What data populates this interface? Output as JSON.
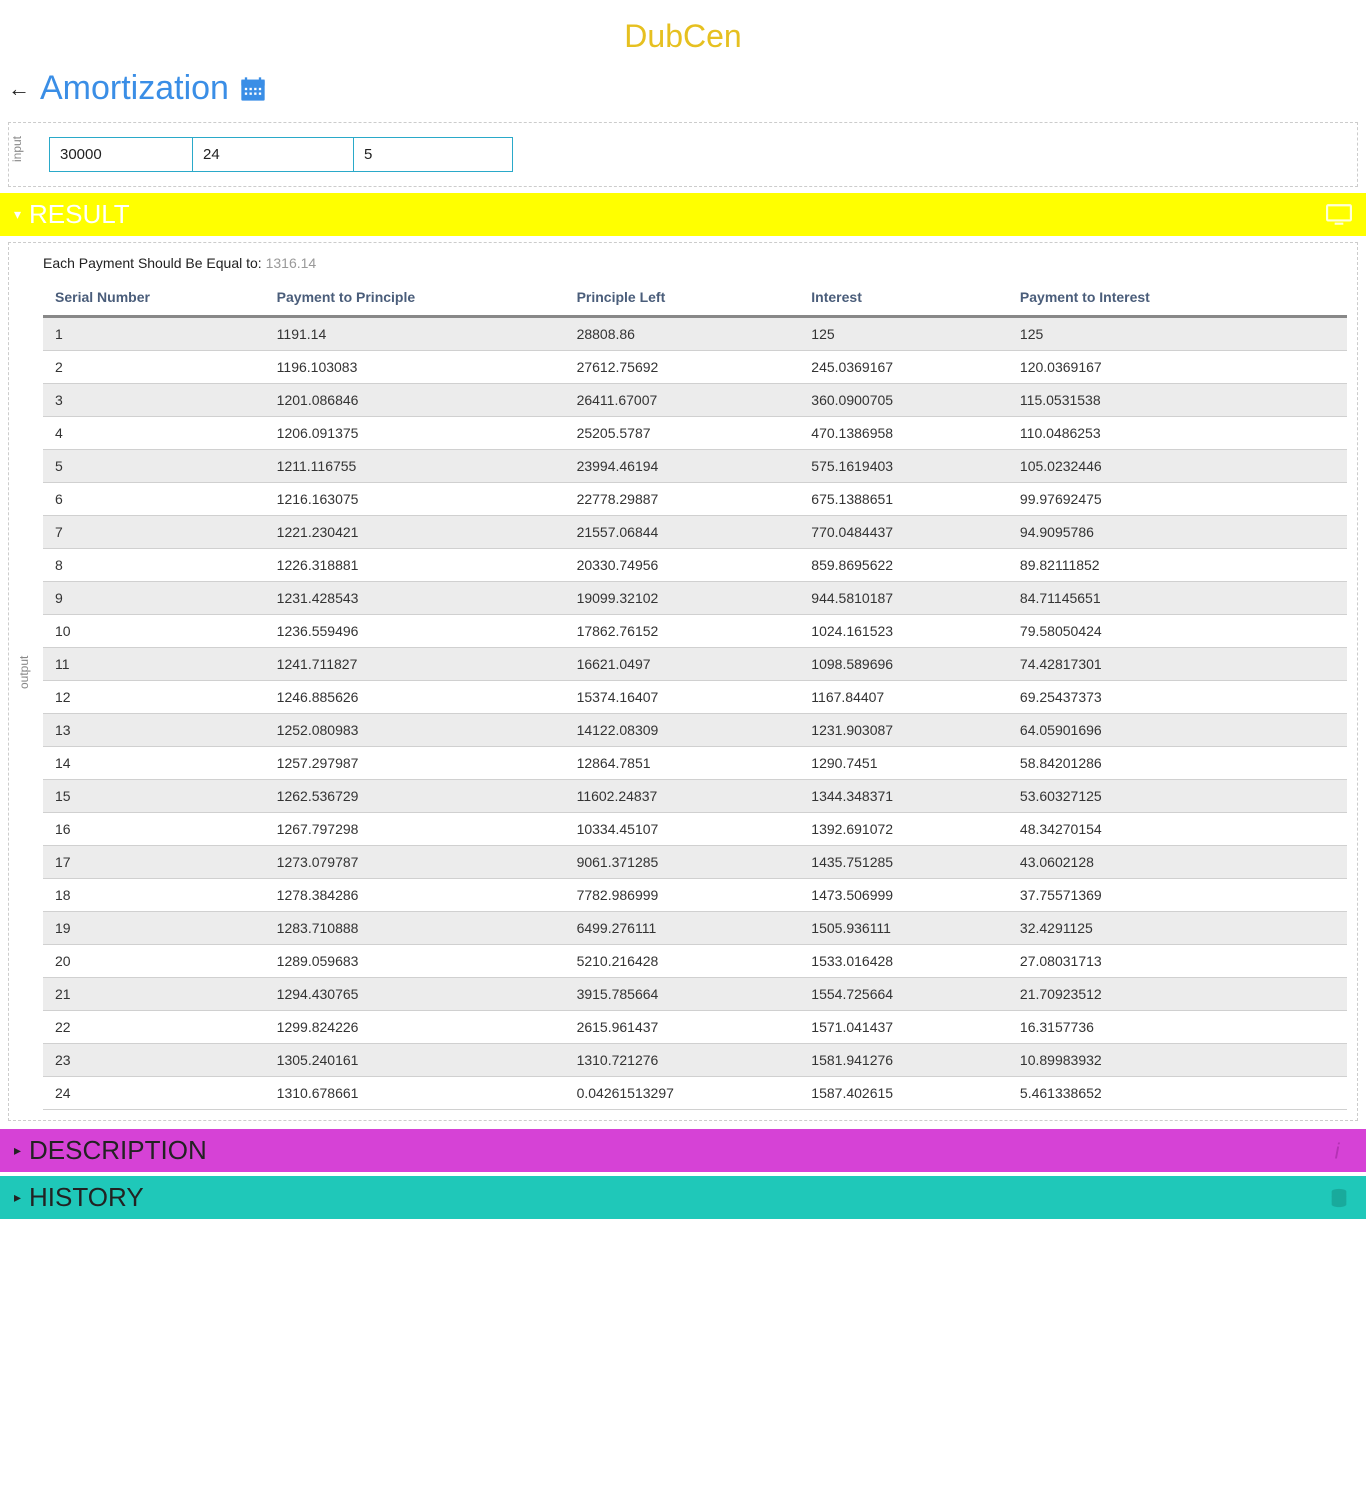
{
  "logo": "DubCen",
  "title": "Amortization",
  "inputLabel": "input",
  "outputLabel": "output",
  "inputs": {
    "principal": "30000",
    "months": "24",
    "rate": "5"
  },
  "sections": {
    "result": "RESULT",
    "description": "DESCRIPTION",
    "history": "HISTORY"
  },
  "paymentLine": {
    "label": "Each Payment Should Be Equal to: ",
    "value": "1316.14"
  },
  "columns": [
    "Serial Number",
    "Payment to Principle",
    "Principle Left",
    "Interest",
    "Payment to Interest"
  ],
  "rows": [
    [
      "1",
      "1191.14",
      "28808.86",
      "125",
      "125"
    ],
    [
      "2",
      "1196.103083",
      "27612.75692",
      "245.0369167",
      "120.0369167"
    ],
    [
      "3",
      "1201.086846",
      "26411.67007",
      "360.0900705",
      "115.0531538"
    ],
    [
      "4",
      "1206.091375",
      "25205.5787",
      "470.1386958",
      "110.0486253"
    ],
    [
      "5",
      "1211.116755",
      "23994.46194",
      "575.1619403",
      "105.0232446"
    ],
    [
      "6",
      "1216.163075",
      "22778.29887",
      "675.1388651",
      "99.97692475"
    ],
    [
      "7",
      "1221.230421",
      "21557.06844",
      "770.0484437",
      "94.9095786"
    ],
    [
      "8",
      "1226.318881",
      "20330.74956",
      "859.8695622",
      "89.82111852"
    ],
    [
      "9",
      "1231.428543",
      "19099.32102",
      "944.5810187",
      "84.71145651"
    ],
    [
      "10",
      "1236.559496",
      "17862.76152",
      "1024.161523",
      "79.58050424"
    ],
    [
      "11",
      "1241.711827",
      "16621.0497",
      "1098.589696",
      "74.42817301"
    ],
    [
      "12",
      "1246.885626",
      "15374.16407",
      "1167.84407",
      "69.25437373"
    ],
    [
      "13",
      "1252.080983",
      "14122.08309",
      "1231.903087",
      "64.05901696"
    ],
    [
      "14",
      "1257.297987",
      "12864.7851",
      "1290.7451",
      "58.84201286"
    ],
    [
      "15",
      "1262.536729",
      "11602.24837",
      "1344.348371",
      "53.60327125"
    ],
    [
      "16",
      "1267.797298",
      "10334.45107",
      "1392.691072",
      "48.34270154"
    ],
    [
      "17",
      "1273.079787",
      "9061.371285",
      "1435.751285",
      "43.0602128"
    ],
    [
      "18",
      "1278.384286",
      "7782.986999",
      "1473.506999",
      "37.75571369"
    ],
    [
      "19",
      "1283.710888",
      "6499.276111",
      "1505.936111",
      "32.4291125"
    ],
    [
      "20",
      "1289.059683",
      "5210.216428",
      "1533.016428",
      "27.08031713"
    ],
    [
      "21",
      "1294.430765",
      "3915.785664",
      "1554.725664",
      "21.70923512"
    ],
    [
      "22",
      "1299.824226",
      "2615.961437",
      "1571.041437",
      "16.3157736"
    ],
    [
      "23",
      "1305.240161",
      "1310.721276",
      "1581.941276",
      "10.89983932"
    ],
    [
      "24",
      "1310.678661",
      "0.04261513297",
      "1587.402615",
      "5.461338652"
    ]
  ]
}
